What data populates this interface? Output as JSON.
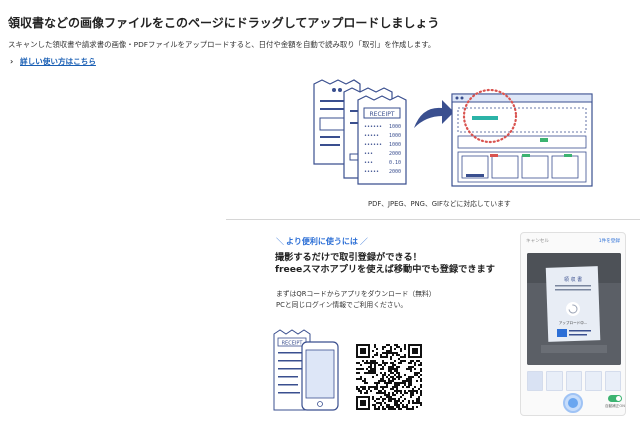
{
  "header": {
    "title": "領収書などの画像ファイルをこのページにドラッグしてアップロードしましょう",
    "description": "スキャンした領収書や請求書の画像・PDFファイルをアップロードすると、日付や金額を自動で読み取り「取引」を作成します。",
    "help_link": "詳しい使い方はこちら"
  },
  "illustration": {
    "receipt_label": "RECEIPT",
    "receipt_amounts": [
      "1000",
      "1000",
      "1000",
      "2000",
      "0.10",
      "2000"
    ],
    "formats_note": "PDF、JPEG、PNG、GIFなどに対応しています"
  },
  "promo": {
    "heading": "より便利に使うには",
    "title_line1": "撮影するだけで取引登録ができる！",
    "title_line2": "freeeスマホアプリを使えば移動中でも登録できます",
    "body_line1": "まずはQRコードからアプリをダウンロード（無料）",
    "body_line2": "PCと同じログイン情報でご利用ください。",
    "phone_receipt_label": "RECEIPT"
  },
  "phone_screen": {
    "cancel": "キャンセル",
    "count": "1件を登録",
    "receipt_title": "領 収 書",
    "upload_label": "アップロード中...",
    "toggle_label": "自動補正ON",
    "accent_color": "#2c6fd6",
    "toggle_color": "#3cb371"
  },
  "icons": {
    "help_chevron": "chevron-right-icon",
    "arrow": "curved-arrow-icon",
    "qr": "qr-code-icon"
  }
}
